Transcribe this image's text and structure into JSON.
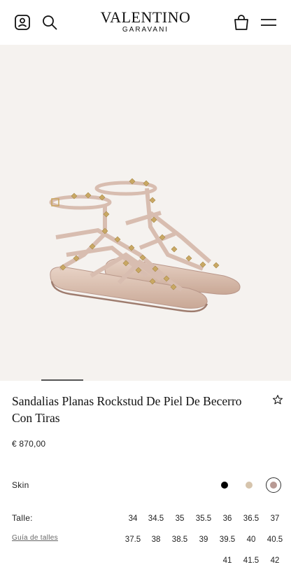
{
  "header": {
    "brand": "VALENTINO",
    "brand_sub": "GARAVANI",
    "icons": [
      "account-icon",
      "search-icon",
      "shopping-bag-icon",
      "menu-icon"
    ]
  },
  "product": {
    "name": "Sandalias Planas Rockstud De Piel De Becerro Con Tiras",
    "price": "€ 870,00",
    "color_label": "Skin",
    "colors": [
      {
        "name": "black",
        "hex": "#000000",
        "selected": false
      },
      {
        "name": "beige",
        "hex": "#d6c4ac",
        "selected": false
      },
      {
        "name": "rose",
        "hex": "#b89a94",
        "selected": true
      }
    ],
    "size_label": "Talle:",
    "size_guide": "Guía de talles",
    "sizes": [
      "34",
      "34.5",
      "35",
      "35.5",
      "36",
      "36.5",
      "37",
      "37.5",
      "38",
      "38.5",
      "39",
      "39.5",
      "40",
      "40.5",
      "41",
      "41.5",
      "42"
    ]
  },
  "gallery": {
    "image": "flat-strappy-rockstud-sandals"
  }
}
